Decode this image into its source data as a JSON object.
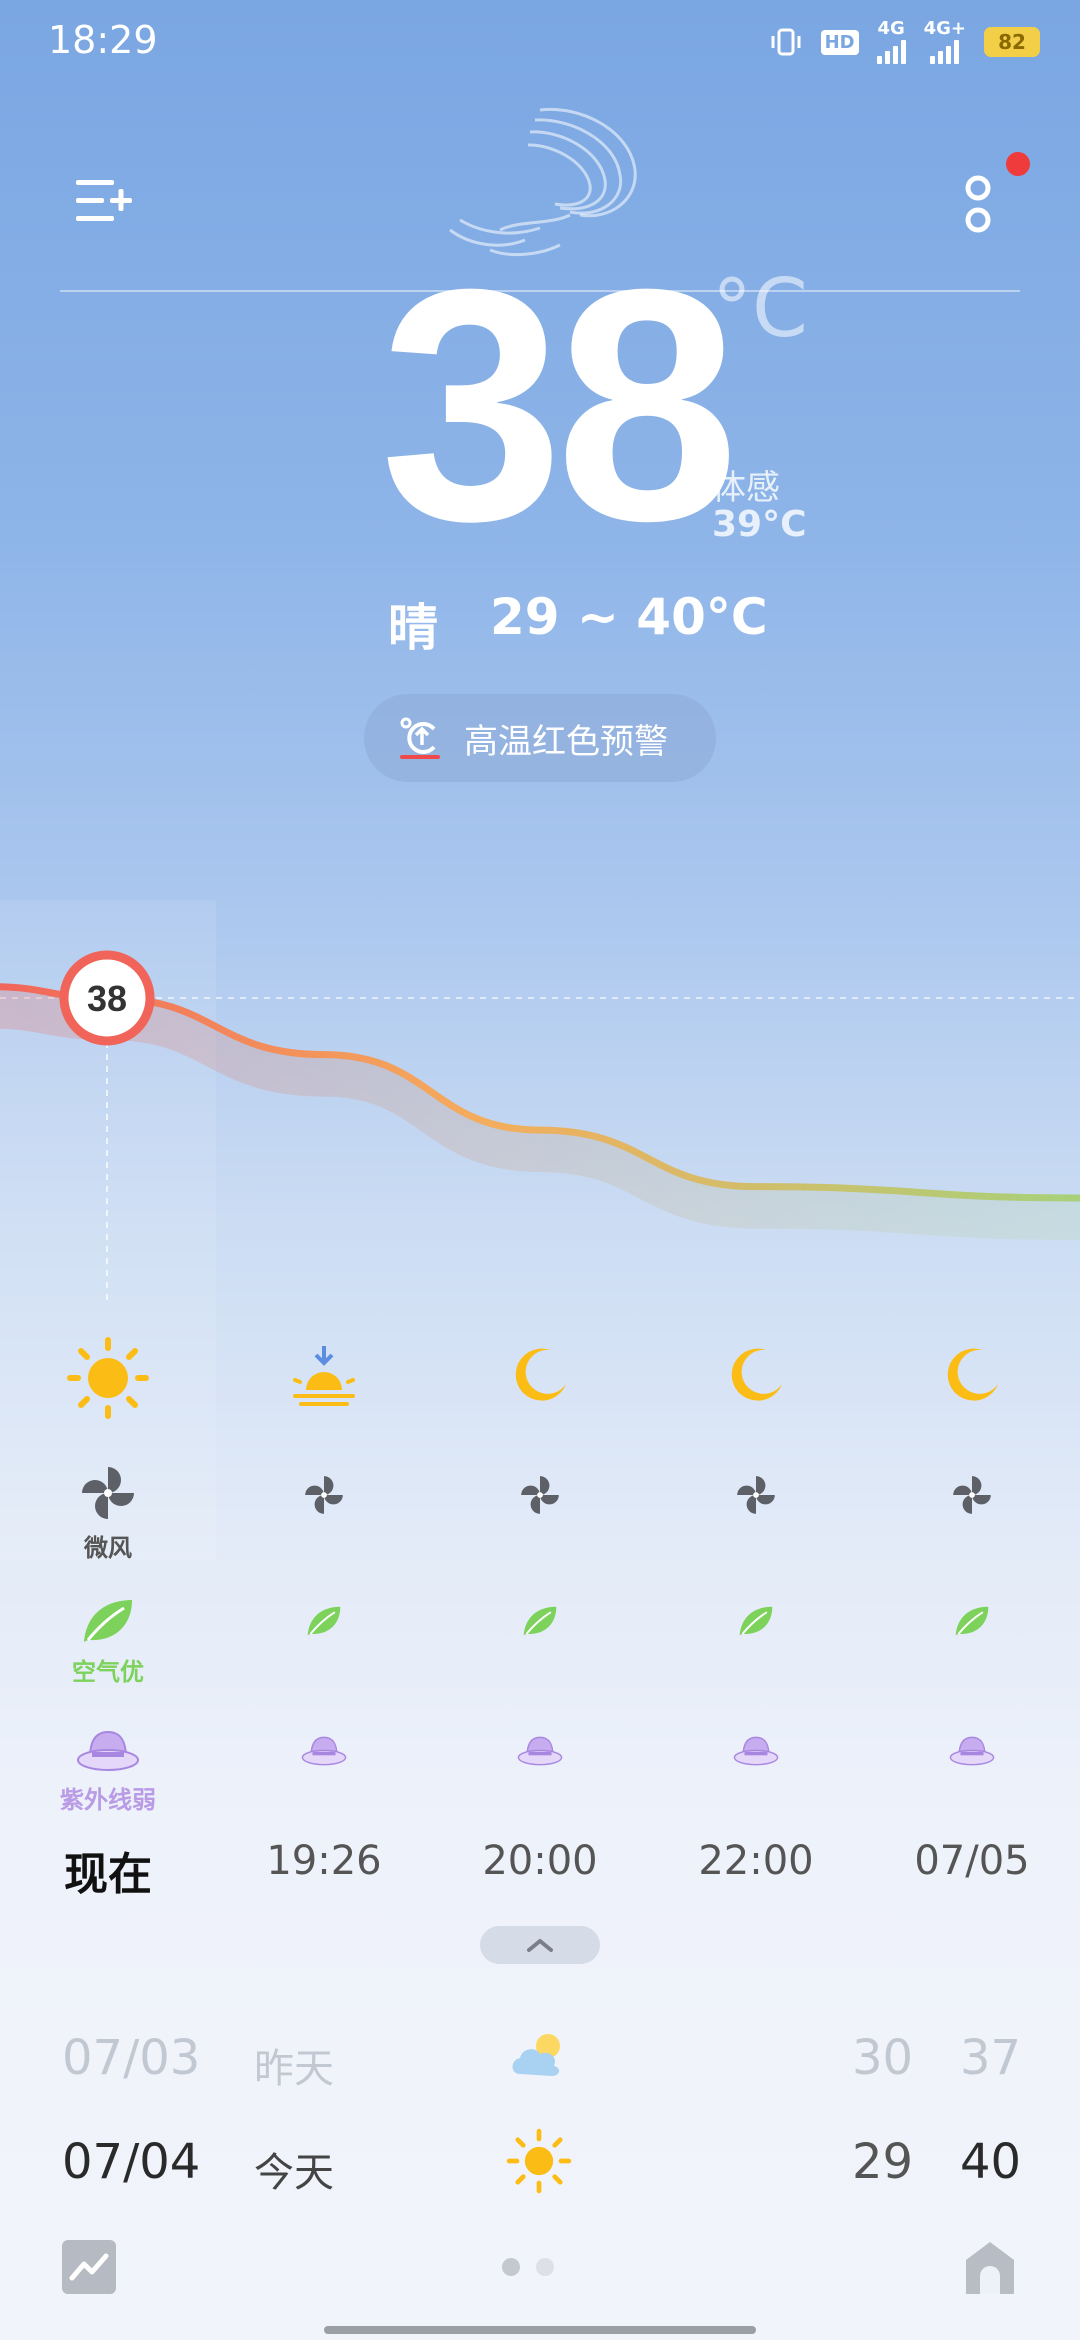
{
  "status_bar": {
    "time": "18:29",
    "hd_label": "HD",
    "network_1": "4G",
    "network_2": "4G+",
    "battery": "82"
  },
  "header": {
    "has_notification": true
  },
  "current": {
    "temperature": "38",
    "unit": "°C",
    "feels_label": "体感",
    "feels_value": "39°C",
    "condition": "晴",
    "range": "29 ~ 40°C"
  },
  "warning": {
    "label": "高温红色预警"
  },
  "chart_data": {
    "type": "line",
    "x": [
      "现在",
      "19:26",
      "20:00",
      "22:00",
      "07/05"
    ],
    "values": [
      38,
      36.5,
      34.5,
      33,
      32.7
    ],
    "marker_label": "38",
    "colors": {
      "hot": "#f1645a",
      "mid": "#f4ad5c",
      "cool": "#a7d17a"
    }
  },
  "hourly": [
    {
      "time": "现在",
      "weather_icon": "sun-icon",
      "wind": "微风",
      "air": "空气优",
      "uv": "紫外线弱"
    },
    {
      "time": "19:26",
      "weather_icon": "sunset-icon"
    },
    {
      "time": "20:00",
      "weather_icon": "moon-icon"
    },
    {
      "time": "22:00",
      "weather_icon": "moon-icon"
    },
    {
      "time": "07/05",
      "weather_icon": "moon-icon"
    }
  ],
  "daily": [
    {
      "date": "07/03",
      "label": "昨天",
      "icon": "partly-cloudy-icon",
      "low": "30",
      "high": "37"
    },
    {
      "date": "07/04",
      "label": "今天",
      "icon": "sun-icon",
      "low": "29",
      "high": "40"
    }
  ],
  "colors": {
    "accent_red": "#ef3b3b",
    "sun": "#fbbd15",
    "wind_icon": "#5e6068",
    "leaf": "#7cd25a",
    "uv": "#b99be6"
  }
}
